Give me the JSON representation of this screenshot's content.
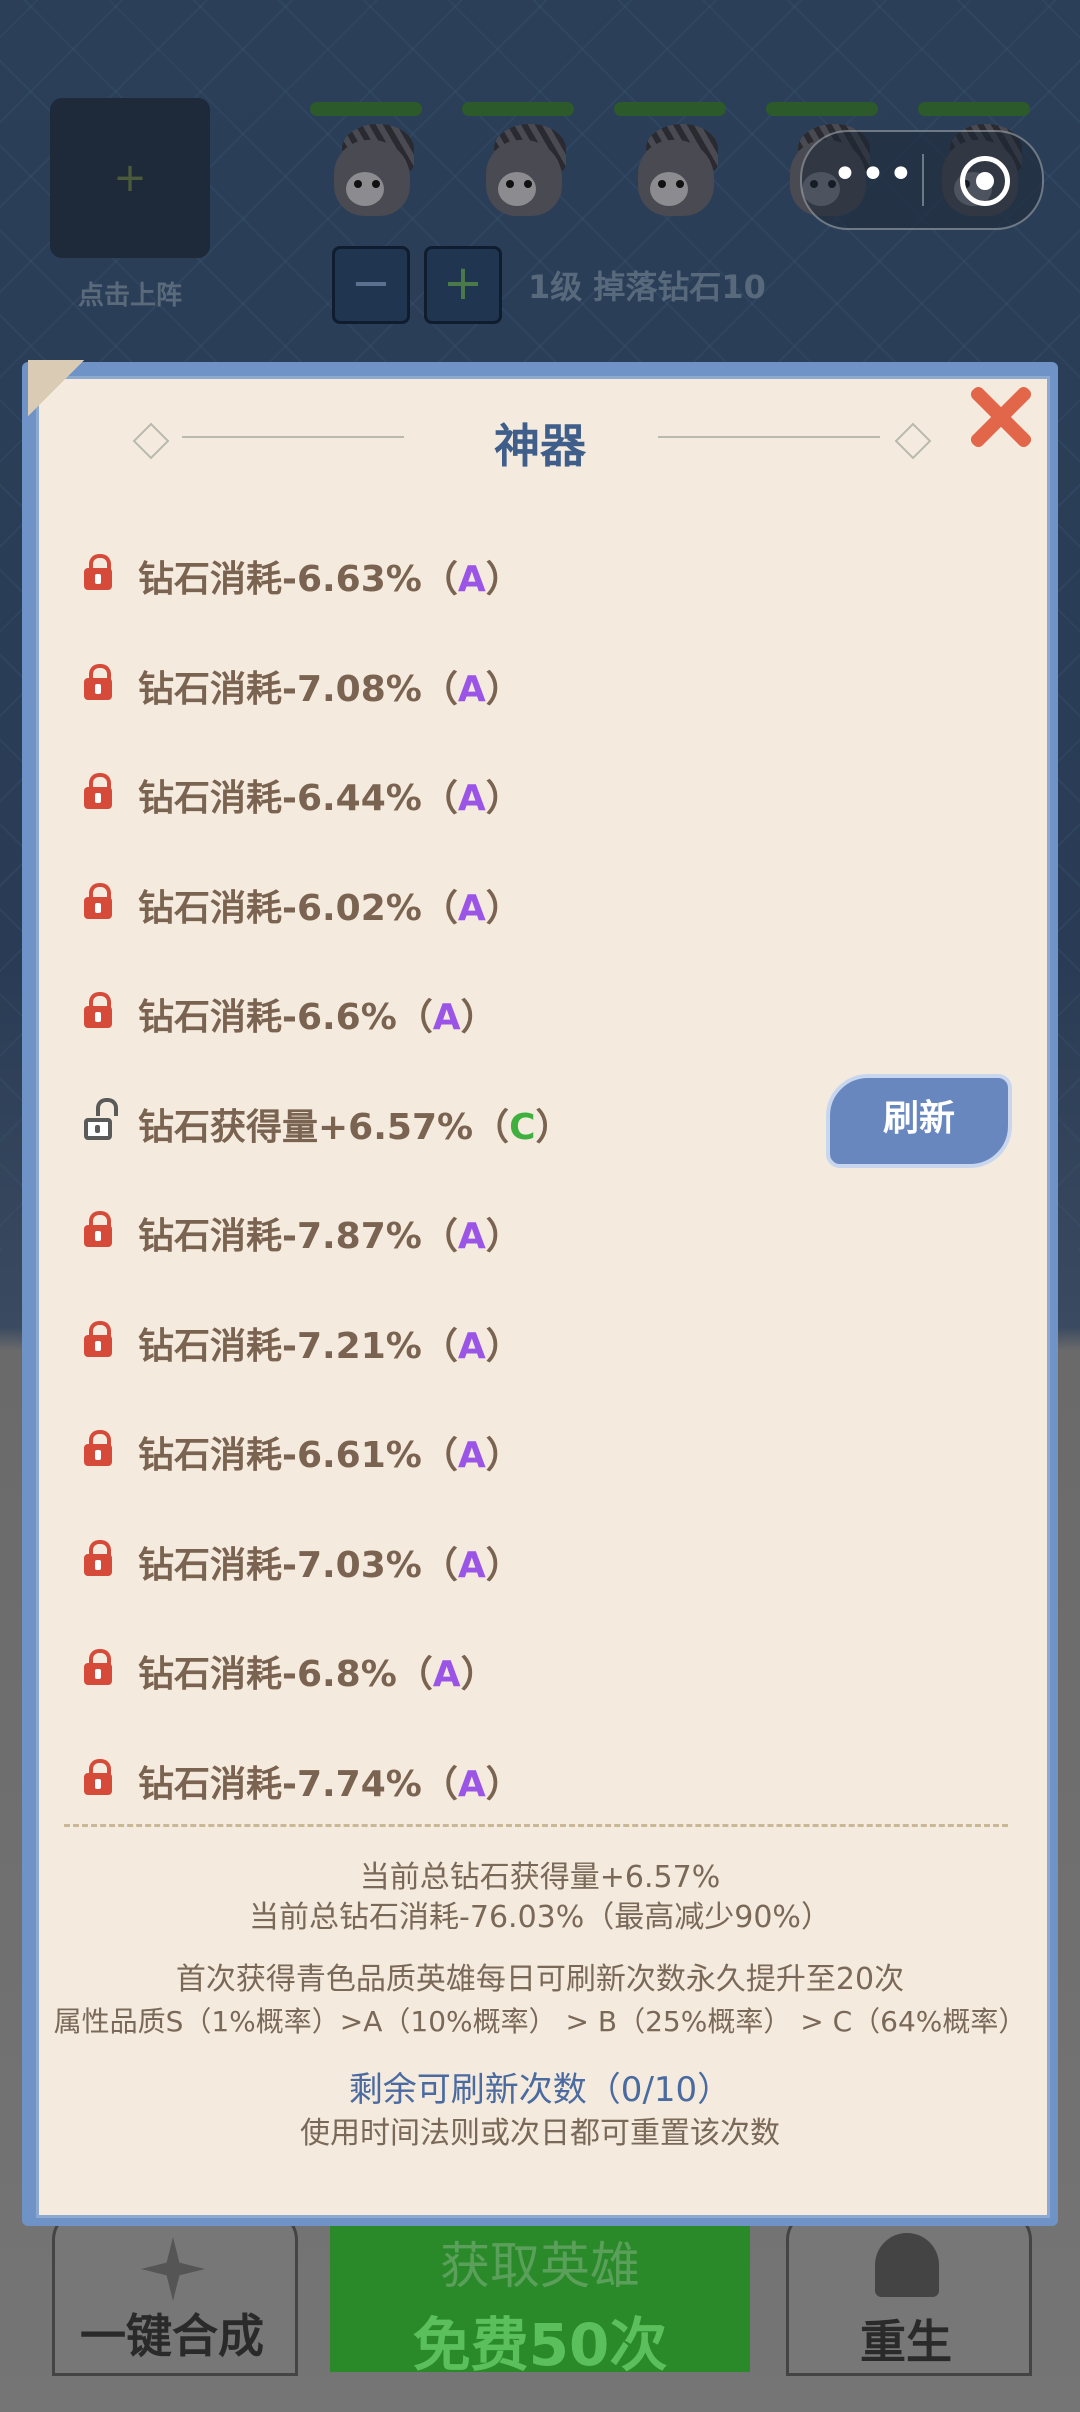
{
  "background": {
    "slot_label": "点击上阵",
    "level_text": "1级 掉落钻石10",
    "minus_label": "−",
    "plus_label": "+",
    "merge_label": "一键合成",
    "get_hero_title": "获取英雄",
    "get_hero_sub": "免费50次",
    "rebirth_label": "重生"
  },
  "modal": {
    "title": "神器",
    "refresh_label": "刷新",
    "items": [
      {
        "text": "钻石消耗-6.63%（",
        "grade": "A",
        "suffix": "）",
        "locked": true
      },
      {
        "text": "钻石消耗-7.08%（",
        "grade": "A",
        "suffix": "）",
        "locked": true
      },
      {
        "text": "钻石消耗-6.44%（",
        "grade": "A",
        "suffix": "）",
        "locked": true
      },
      {
        "text": "钻石消耗-6.02%（",
        "grade": "A",
        "suffix": "）",
        "locked": true
      },
      {
        "text": "钻石消耗-6.6%（",
        "grade": "A",
        "suffix": "）",
        "locked": true
      },
      {
        "text": "钻石获得量+6.57%（",
        "grade": "C",
        "suffix": "）",
        "locked": false
      },
      {
        "text": "钻石消耗-7.87%（",
        "grade": "A",
        "suffix": "）",
        "locked": true
      },
      {
        "text": "钻石消耗-7.21%（",
        "grade": "A",
        "suffix": "）",
        "locked": true
      },
      {
        "text": "钻石消耗-6.61%（",
        "grade": "A",
        "suffix": "）",
        "locked": true
      },
      {
        "text": "钻石消耗-7.03%（",
        "grade": "A",
        "suffix": "）",
        "locked": true
      },
      {
        "text": "钻石消耗-6.8%（",
        "grade": "A",
        "suffix": "）",
        "locked": true
      },
      {
        "text": "钻石消耗-7.74%（",
        "grade": "A",
        "suffix": "）",
        "locked": true
      }
    ],
    "total_gain": "当前总钻石获得量+6.57%",
    "total_cost": "当前总钻石消耗-76.03%（最高减少90%）",
    "note_refresh": "首次获得青色品质英雄每日可刷新次数永久提升至20次",
    "note_quality": "属性品质S（1%概率）>A（10%概率） > B（25%概率） > C（64%概率）",
    "remaining": "剩余可刷新次数（0/10）",
    "reset_note": "使用时间法则或次日都可重置该次数"
  },
  "colors": {
    "grade_a": "#9a55e6",
    "grade_c": "#3fb03f",
    "title": "#3f5e8a",
    "close": "#e2664a",
    "refresh_button": "#6887be"
  }
}
